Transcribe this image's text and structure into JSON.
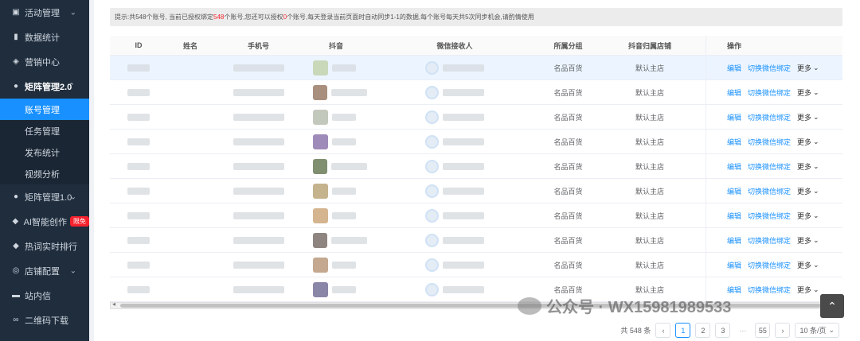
{
  "sidebar": {
    "items": [
      {
        "label": "活动管理",
        "icon": "calendar-icon",
        "chevron": "⌄"
      },
      {
        "label": "数据统计",
        "icon": "bar-chart-icon"
      },
      {
        "label": "营销中心",
        "icon": "layers-icon"
      },
      {
        "label": "矩阵管理2.0",
        "icon": "user-icon",
        "chevron": "⌃"
      },
      {
        "label": "矩阵管理1.0",
        "icon": "user-icon",
        "chevron": "⌄"
      },
      {
        "label": "AI智能创作",
        "icon": "droplet-icon",
        "badge": "限免"
      },
      {
        "label": "热词实时排行",
        "icon": "fire-icon"
      },
      {
        "label": "店铺配置",
        "icon": "gear-icon",
        "chevron": "⌄"
      },
      {
        "label": "站内信",
        "icon": "message-icon"
      },
      {
        "label": "二维码下载",
        "icon": "link-icon"
      }
    ],
    "subitems": [
      "账号管理",
      "任务管理",
      "发布统计",
      "视频分析"
    ]
  },
  "notice": {
    "p1": "提示:共548个账号, 当前已授权绑定",
    "red1": "548",
    "p2": "个账号,您还可以授权",
    "red2": "0",
    "p3": "个账号,每天登录当前页面时自动同步1-1的数据,每个账号每天共5次同步机会,请酌情使用"
  },
  "table": {
    "headers": [
      "ID",
      "姓名",
      "手机号",
      "抖音",
      "微信接收人",
      "所属分组",
      "抖音归属店铺",
      "操作"
    ],
    "rows": [
      {
        "group": "名品百货",
        "shop": "默认主店"
      },
      {
        "group": "名品百货",
        "shop": "默认主店"
      },
      {
        "group": "名品百货",
        "shop": "默认主店"
      },
      {
        "group": "名品百货",
        "shop": "默认主店"
      },
      {
        "group": "名品百货",
        "shop": "默认主店"
      },
      {
        "group": "名品百货",
        "shop": "默认主店"
      },
      {
        "group": "名品百货",
        "shop": "默认主店"
      },
      {
        "group": "名品百货",
        "shop": "默认主店"
      },
      {
        "group": "名品百货",
        "shop": "默认主店"
      },
      {
        "group": "名品百货",
        "shop": "默认主店"
      }
    ],
    "ops": {
      "edit": "编辑",
      "switch": "切换微信绑定",
      "more": "更多"
    }
  },
  "pagination": {
    "total": "共 548 条",
    "pages": [
      "1",
      "2",
      "3",
      "···",
      "55"
    ],
    "prev": "‹",
    "next": "›",
    "size": "10 条/页"
  },
  "watermark": "公众号 · WX15981989533",
  "colors": {
    "primary": "#1890ff",
    "sidebar": "#1f2d3d",
    "badge": "#f5222d"
  }
}
